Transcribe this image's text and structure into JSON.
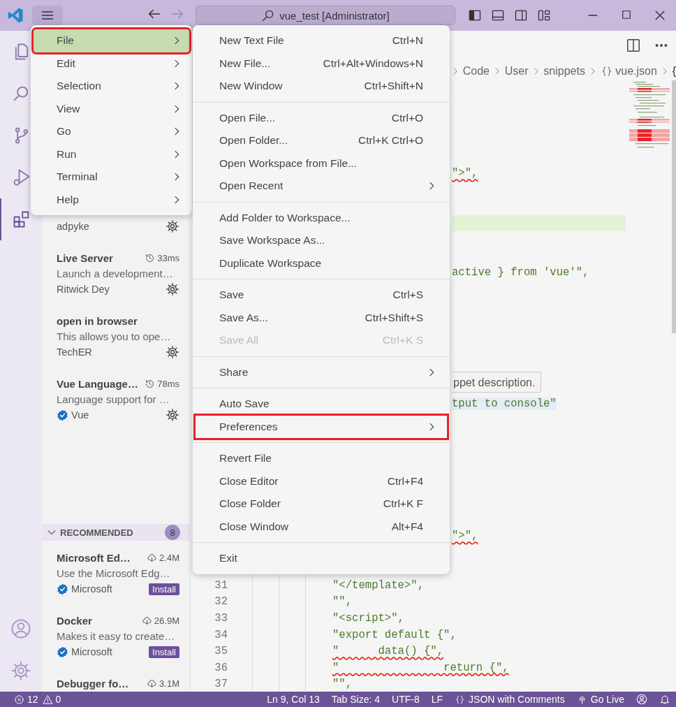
{
  "title_bar": {
    "search_label": "vue_test [Administrator]"
  },
  "activity_bar": {
    "items": [
      {
        "kind": "files",
        "selected": false
      },
      {
        "kind": "search",
        "selected": false
      },
      {
        "kind": "source-control",
        "selected": false
      },
      {
        "kind": "run-debug",
        "selected": false
      },
      {
        "kind": "extensions",
        "selected": true
      }
    ],
    "bottom": [
      {
        "kind": "account"
      },
      {
        "kind": "settings"
      }
    ]
  },
  "sidebar": {
    "installed": [
      {
        "publisher": "adpyke",
        "verified": false,
        "action": {
          "kind": "manage"
        }
      },
      {
        "name": "Live Server",
        "kind": "time",
        "meta": "33ms",
        "description": "Launch a development…",
        "publisher": "Ritwick Dey",
        "verified": false,
        "action": {
          "kind": "manage"
        }
      },
      {
        "name": "open in browser",
        "description": "This allows you to ope…",
        "publisher": "TechER",
        "verified": false,
        "action": {
          "kind": "manage"
        }
      },
      {
        "name": "Vue Language…",
        "kind": "time",
        "meta": "78ms",
        "description": "Language support for …",
        "publisher": "Vue",
        "verified": true,
        "action": {
          "kind": "manage"
        }
      }
    ],
    "recommended": {
      "title": "RECOMMENDED",
      "count": "8",
      "expanded": true,
      "items": [
        {
          "name": "Microsoft Ed…",
          "kind": "downloads",
          "meta": "2.4M",
          "description": "Use the Microsoft Edg…",
          "publisher": "Microsoft",
          "verified": true,
          "action": {
            "kind": "install",
            "label": "Install"
          }
        },
        {
          "name": "Docker",
          "kind": "downloads",
          "meta": "26.9M",
          "description": "Makes it easy to create…",
          "publisher": "Microsoft",
          "verified": true,
          "action": {
            "kind": "install",
            "label": "Install"
          }
        },
        {
          "name": "Debugger fo…",
          "kind": "downloads",
          "meta": "3.1M"
        }
      ]
    }
  },
  "menu": {
    "items": [
      {
        "label": "File",
        "selected": true,
        "annotated": true
      },
      {
        "label": "Edit",
        "selected": false,
        "annotated": false
      },
      {
        "label": "Selection",
        "selected": false,
        "annotated": false
      },
      {
        "label": "View",
        "selected": false,
        "annotated": false
      },
      {
        "label": "Go",
        "selected": false,
        "annotated": false
      },
      {
        "label": "Run",
        "selected": false,
        "annotated": false
      },
      {
        "label": "Terminal",
        "selected": false,
        "annotated": false
      },
      {
        "label": "Help",
        "selected": false,
        "annotated": false
      }
    ]
  },
  "submenu": {
    "groups": [
      {
        "items": [
          {
            "kind": "command",
            "label": "New Text File",
            "shortcut": "Ctrl+N",
            "disabled": false,
            "annotated": false
          },
          {
            "kind": "command",
            "label": "New File...",
            "shortcut": "Ctrl+Alt+Windows+N",
            "disabled": false,
            "annotated": false
          },
          {
            "kind": "command",
            "label": "New Window",
            "shortcut": "Ctrl+Shift+N",
            "disabled": false,
            "annotated": false
          }
        ]
      },
      {
        "items": [
          {
            "kind": "command",
            "label": "Open File...",
            "shortcut": "Ctrl+O",
            "disabled": false,
            "annotated": false
          },
          {
            "kind": "command",
            "label": "Open Folder...",
            "shortcut": "Ctrl+K Ctrl+O",
            "disabled": false,
            "annotated": false
          },
          {
            "kind": "command",
            "label": "Open Workspace from File...",
            "disabled": false,
            "annotated": false
          },
          {
            "kind": "submenu",
            "label": "Open Recent",
            "disabled": false,
            "annotated": false
          }
        ]
      },
      {
        "items": [
          {
            "kind": "command",
            "label": "Add Folder to Workspace...",
            "disabled": false,
            "annotated": false
          },
          {
            "kind": "command",
            "label": "Save Workspace As...",
            "disabled": false,
            "annotated": false
          },
          {
            "kind": "command",
            "label": "Duplicate Workspace",
            "disabled": false,
            "annotated": false
          }
        ]
      },
      {
        "items": [
          {
            "kind": "command",
            "label": "Save",
            "shortcut": "Ctrl+S",
            "disabled": false,
            "annotated": false
          },
          {
            "kind": "command",
            "label": "Save As...",
            "shortcut": "Ctrl+Shift+S",
            "disabled": false,
            "annotated": false
          },
          {
            "kind": "command",
            "label": "Save All",
            "shortcut": "Ctrl+K S",
            "disabled": true,
            "annotated": false
          }
        ]
      },
      {
        "items": [
          {
            "kind": "submenu",
            "label": "Share",
            "disabled": false,
            "annotated": false
          }
        ]
      },
      {
        "items": [
          {
            "kind": "command",
            "label": "Auto Save",
            "disabled": false,
            "annotated": false
          },
          {
            "kind": "submenu",
            "label": "Preferences",
            "disabled": false,
            "annotated": true
          }
        ]
      },
      {
        "items": [
          {
            "kind": "command",
            "label": "Revert File",
            "disabled": false,
            "annotated": false
          },
          {
            "kind": "command",
            "label": "Close Editor",
            "shortcut": "Ctrl+F4",
            "disabled": false,
            "annotated": false
          },
          {
            "kind": "command",
            "label": "Close Folder",
            "shortcut": "Ctrl+K F",
            "disabled": false,
            "annotated": false
          },
          {
            "kind": "command",
            "label": "Close Window",
            "shortcut": "Alt+F4",
            "disabled": false,
            "annotated": false
          }
        ]
      },
      {
        "items": [
          {
            "kind": "command",
            "label": "Exit",
            "disabled": false,
            "annotated": false
          }
        ]
      }
    ]
  },
  "editor": {
    "breadcrumb": [
      {
        "kind": "folder",
        "label": "Code"
      },
      {
        "kind": "folder",
        "label": "User"
      },
      {
        "kind": "folder",
        "label": "snippets"
      },
      {
        "kind": "file",
        "label": "vue.json"
      },
      {
        "kind": "symbol",
        "label": "{"
      }
    ],
    "lines": [
      {
        "kind": "hidden"
      },
      {
        "kind": "hidden"
      },
      {
        "kind": "hidden"
      },
      {
        "kind": "hidden"
      },
      {
        "kind": "hidden"
      },
      {
        "kind": "clipped",
        "text": "\">\",",
        "squiggle": true,
        "match": false
      },
      {
        "kind": "hidden"
      },
      {
        "kind": "hidden"
      },
      {
        "kind": "current"
      },
      {
        "kind": "hidden"
      },
      {
        "kind": "hidden"
      },
      {
        "kind": "clipped",
        "text": "active } from 'vue'\",",
        "squiggle": false,
        "match": false
      },
      {
        "kind": "hidden"
      },
      {
        "kind": "hidden"
      },
      {
        "kind": "hidden"
      },
      {
        "kind": "hidden"
      },
      {
        "kind": "hidden"
      },
      {
        "kind": "hidden"
      },
      {
        "kind": "hover",
        "text": "ppet description."
      },
      {
        "kind": "clipped",
        "text": "tput to console\"",
        "squiggle": false,
        "match": true
      },
      {
        "kind": "hidden"
      },
      {
        "kind": "hidden"
      },
      {
        "kind": "hidden"
      },
      {
        "kind": "hidden"
      },
      {
        "kind": "hidden"
      },
      {
        "kind": "hidden"
      },
      {
        "kind": "hidden"
      },
      {
        "kind": "clipped",
        "text": "\">\",",
        "squiggle": true,
        "match": false
      },
      {
        "kind": "hidden"
      },
      {
        "kind": "hidden"
      },
      {
        "kind": "full",
        "number": "31",
        "text": "\"</template>\",",
        "squiggle": false,
        "match": false
      },
      {
        "kind": "full",
        "number": "32",
        "text": "\"\",",
        "squiggle": false,
        "match": false
      },
      {
        "kind": "full",
        "number": "33",
        "text": "\"<script>\",",
        "squiggle": false,
        "match": false
      },
      {
        "kind": "full",
        "number": "34",
        "text": "\"export default {\",",
        "squiggle": false,
        "match": false
      },
      {
        "kind": "full",
        "number": "35",
        "text": "\"      data() {\",",
        "squiggle": true,
        "match": false
      },
      {
        "kind": "full",
        "number": "36",
        "text": "\"                return {\",",
        "squiggle": true,
        "match": false
      },
      {
        "kind": "full",
        "number": "37",
        "text": "\"\",",
        "squiggle": false,
        "match": false
      }
    ]
  },
  "status_bar": {
    "errors": "12",
    "warnings": "0",
    "items": [
      {
        "kind": "text",
        "label": "Ln 9, Col 13"
      },
      {
        "kind": "text",
        "label": "Tab Size: 4"
      },
      {
        "kind": "text",
        "label": "UTF-8"
      },
      {
        "kind": "text",
        "label": "LF"
      },
      {
        "kind": "language",
        "label": "JSON with Comments"
      },
      {
        "kind": "live",
        "label": "Go Live"
      },
      {
        "kind": "account"
      },
      {
        "kind": "notifications"
      }
    ]
  }
}
